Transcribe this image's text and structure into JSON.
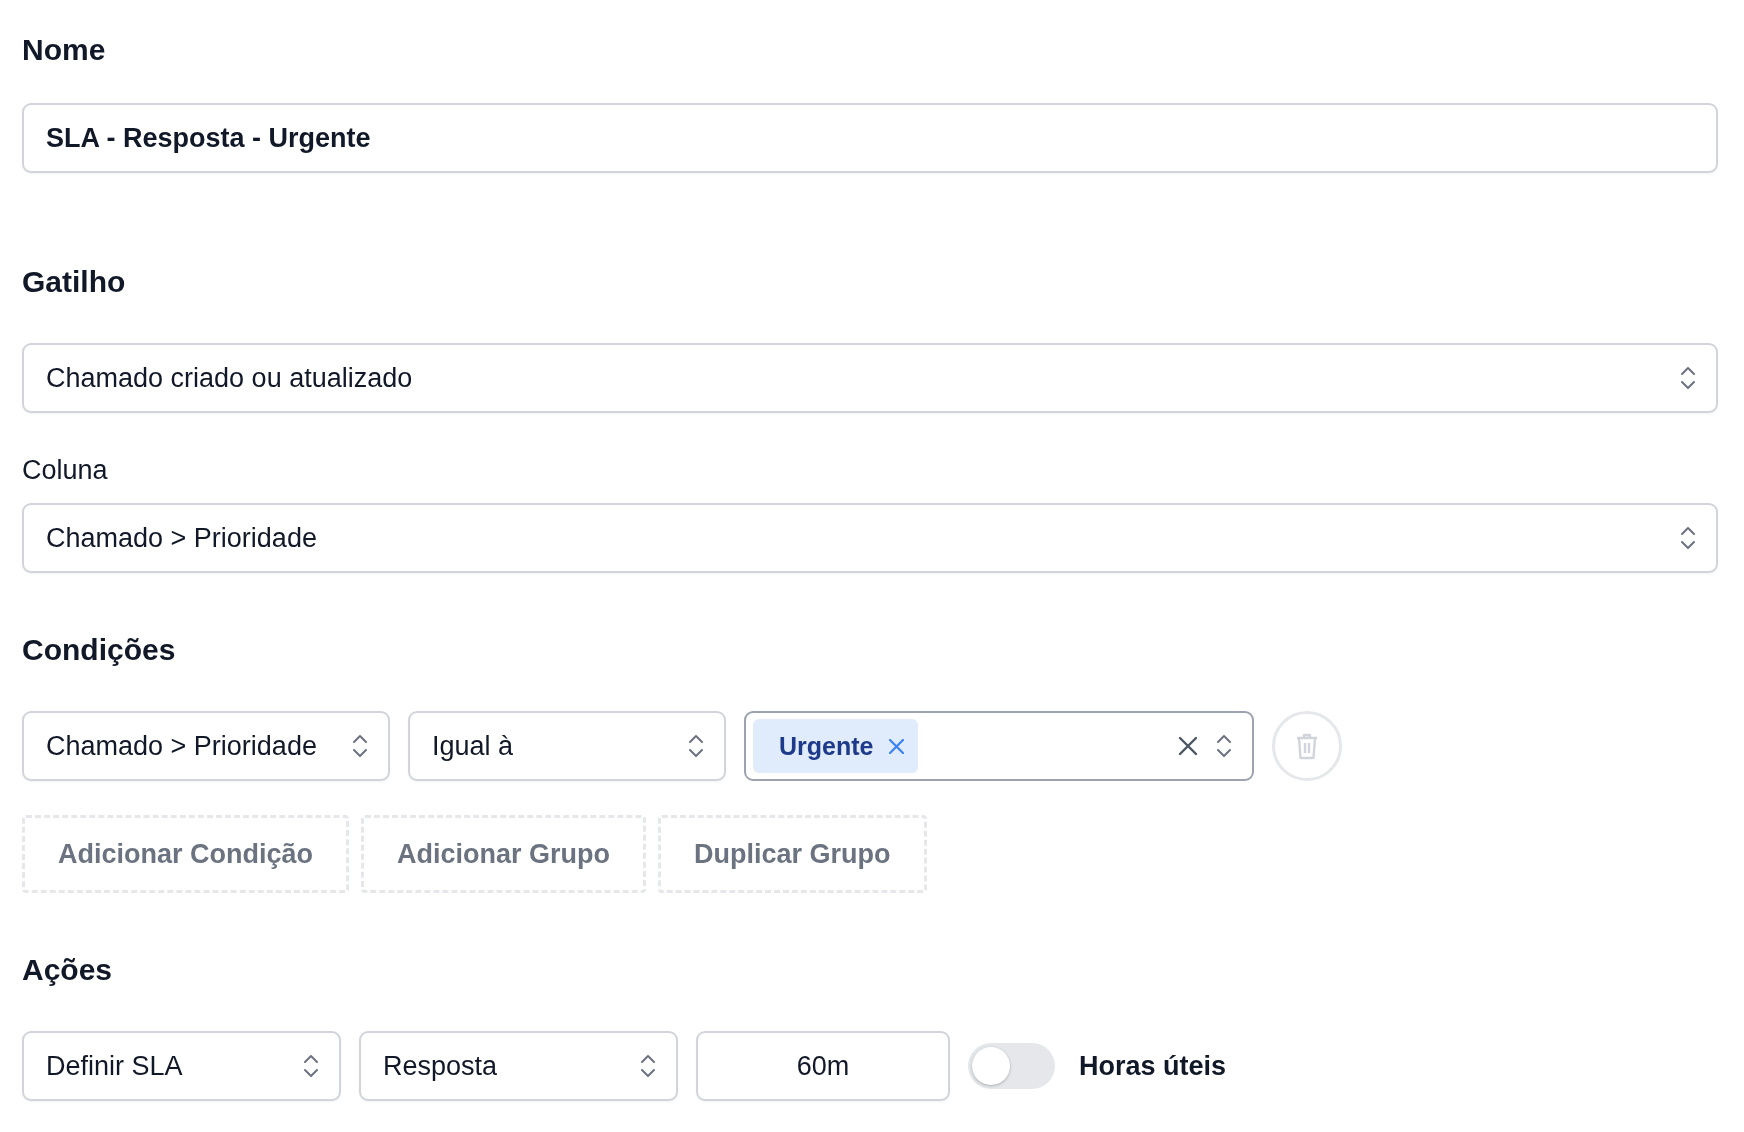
{
  "name_section": {
    "heading": "Nome",
    "value": "SLA - Resposta - Urgente"
  },
  "trigger": {
    "heading": "Gatilho",
    "select": "Chamado criado ou atualizado"
  },
  "column": {
    "label": "Coluna",
    "select": "Chamado > Prioridade"
  },
  "conditions": {
    "heading": "Condições",
    "rows": [
      {
        "field": "Chamado > Prioridade",
        "operator": "Igual à",
        "values": [
          {
            "label": "Urgente"
          }
        ]
      }
    ],
    "buttons": [
      "Adicionar Condição",
      "Adicionar Grupo",
      "Duplicar Grupo"
    ]
  },
  "actions": {
    "heading": "Ações",
    "rows": [
      {
        "action": "Definir SLA",
        "type": "Resposta",
        "value": "60m",
        "toggle": {
          "label": "Horas úteis",
          "on": false
        }
      }
    ]
  }
}
